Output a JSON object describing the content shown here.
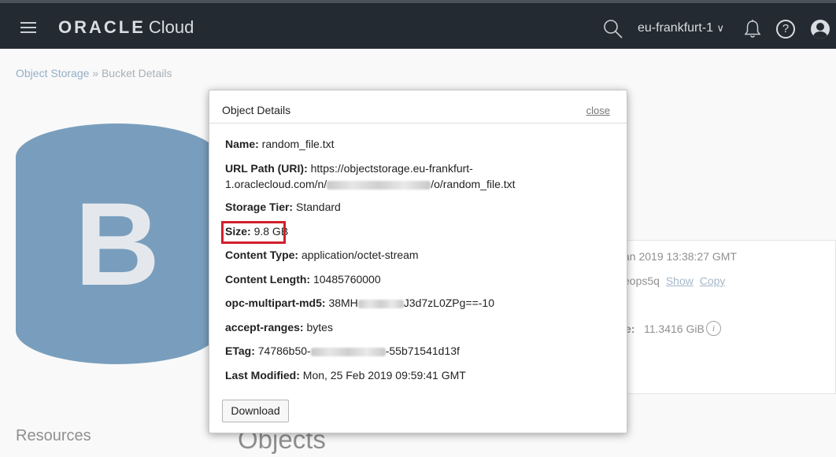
{
  "header": {
    "brand_oracle": "ORACLE",
    "brand_cloud": "Cloud",
    "region": "eu-frankfurt-1 ",
    "region_caret": "∨",
    "help_glyph": "?"
  },
  "breadcrumb": {
    "parent": "Object Storage",
    "separator": " » ",
    "current": "Bucket Details"
  },
  "bucket": {
    "letter": "B"
  },
  "info_panel": {
    "created": "an 2019 13:38:27 GMT",
    "namespace_tail": "eops5q",
    "show_link": "Show",
    "copy_link": "Copy",
    "size_label_tail": "e:",
    "approx_size": "11.3416 GiB",
    "info_glyph": "i"
  },
  "page": {
    "resources_label": "Resources",
    "objects_heading": "Objects"
  },
  "modal": {
    "title": "Object Details",
    "close_label": "close",
    "fields": [
      {
        "label": "Name:",
        "value": " random_file.txt"
      },
      {
        "label": "URL Path (URI):",
        "value": " https://objectstorage.eu-frankfurt-",
        "value_line2_prefix": "1.oraclecloud.com/n/",
        "value_line2_suffix": "/o/random_file.txt"
      },
      {
        "label": "Storage Tier:",
        "value": " Standard"
      },
      {
        "label": "Size:",
        "value": " 9.8 GB"
      },
      {
        "label": "Content Type:",
        "value": " application/octet-stream"
      },
      {
        "label": "Content Length:",
        "value": " 10485760000"
      },
      {
        "label": "opc-multipart-md5:",
        "value_prefix": " 38MH",
        "value_suffix": "J3d7zL0ZPg==-10"
      },
      {
        "label": "accept-ranges:",
        "value": " bytes"
      },
      {
        "label": "ETag:",
        "value_prefix": " 74786b50-",
        "value_suffix": "-55b71541d13f"
      },
      {
        "label": "Last Modified:",
        "value": " Mon, 25 Feb 2019 09:59:41 GMT"
      }
    ],
    "download_label": "Download"
  },
  "colors": {
    "nav_background": "#232a31",
    "bucket_blue": "#0b4f87",
    "highlight_red": "#d0202b",
    "link_blue": "#3a6d9a"
  }
}
